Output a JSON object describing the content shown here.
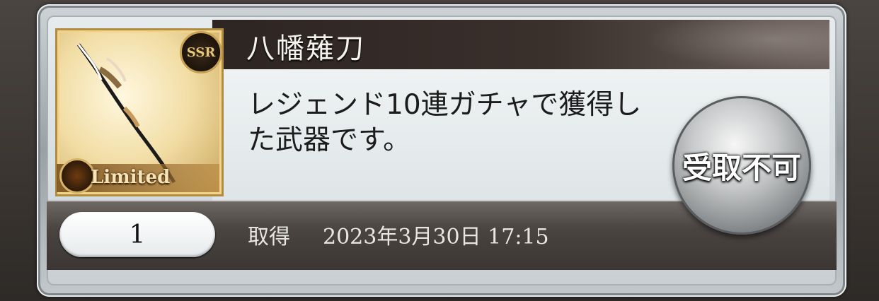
{
  "item": {
    "name": "八幡薙刀",
    "description": "レジェンド10連ガチャで獲得した武器です。",
    "rarity_badge": "SSR",
    "limited_label": "Limited",
    "thumbnail_icon": "naginata-weapon-icon"
  },
  "quantity": "1",
  "acquired": {
    "label": "取得",
    "datetime": "2023年3月30日  17:15"
  },
  "action": {
    "label": "受取不可",
    "enabled": false
  },
  "colors": {
    "title_bar": "#2d2522",
    "panel": "#e6ebed",
    "button_metal": "#c9cbcc"
  }
}
